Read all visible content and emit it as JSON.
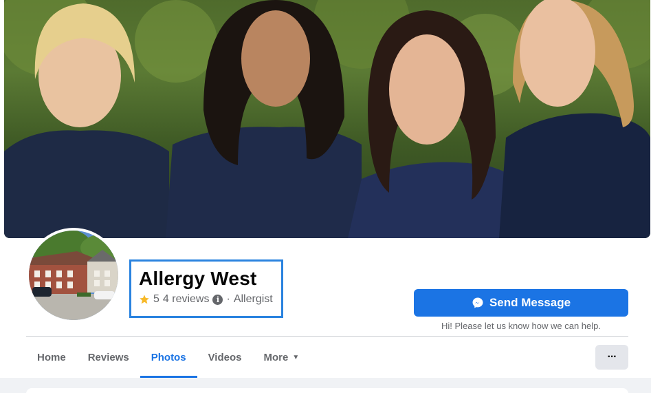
{
  "page": {
    "name": "Allergy West",
    "rating_value": "5",
    "reviews_text": "4 reviews",
    "separator": "·",
    "category": "Allergist"
  },
  "actions": {
    "send_message_label": "Send Message",
    "help_text": "Hi! Please let us know how we can help."
  },
  "tabs": [
    {
      "label": "Home",
      "active": false
    },
    {
      "label": "Reviews",
      "active": false
    },
    {
      "label": "Photos",
      "active": true
    },
    {
      "label": "Videos",
      "active": false
    },
    {
      "label": "More",
      "active": false
    }
  ],
  "overflow_button": {
    "label": "···"
  },
  "icons": {
    "rating": "star-icon",
    "info": "info-icon",
    "message": "messenger-icon",
    "dropdown": "caret-down-icon"
  },
  "colors": {
    "accent": "#1b74e4",
    "highlight_border": "#2a83df",
    "star": "#f7b928",
    "secondary_text": "#65676b"
  }
}
